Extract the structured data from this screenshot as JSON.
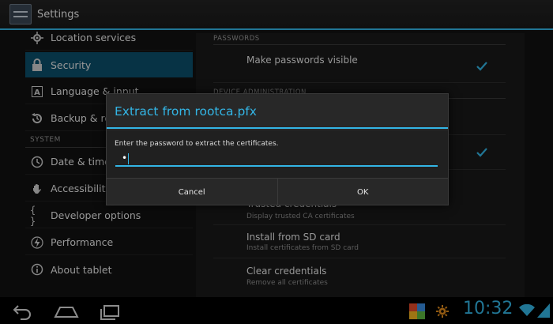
{
  "actionbar": {
    "title": "Settings",
    "icon": "settings-app-icon"
  },
  "sidebar": {
    "items": [
      {
        "label": "Location services",
        "icon": "location-icon"
      },
      {
        "label": "Security",
        "icon": "lock-icon",
        "selected": true
      },
      {
        "label": "Language & input",
        "icon": "keyboard-a-icon"
      },
      {
        "label": "Backup & reset",
        "icon": "backup-restore-icon"
      }
    ],
    "system_header": "SYSTEM",
    "system_items": [
      {
        "label": "Date & time",
        "icon": "clock-icon"
      },
      {
        "label": "Accessibility",
        "icon": "hand-icon"
      },
      {
        "label": "Developer options",
        "icon": "braces-icon"
      },
      {
        "label": "Performance",
        "icon": "lightning-icon"
      },
      {
        "label": "About tablet",
        "icon": "info-icon"
      }
    ]
  },
  "preferences": {
    "passwords_header": "PASSWORDS",
    "make_passwords_visible": "Make passwords visible",
    "device_admin_header": "DEVICE ADMINISTRATION",
    "trusted_credentials_title": "Trusted credentials",
    "trusted_credentials_sub": "Display trusted CA certificates",
    "install_sd_title": "Install from SD card",
    "install_sd_sub": "Install certificates from SD card",
    "clear_credentials_title": "Clear credentials",
    "clear_credentials_sub": "Remove all certificates"
  },
  "dialog": {
    "title": "Extract from rootca.pfx",
    "message": "Enter the password to extract the certificates.",
    "password_value": "•",
    "cancel_label": "Cancel",
    "ok_label": "OK"
  },
  "status": {
    "time": "10:32"
  },
  "colors": {
    "accent": "#33b5e5",
    "selected": "#0b4f6a"
  }
}
